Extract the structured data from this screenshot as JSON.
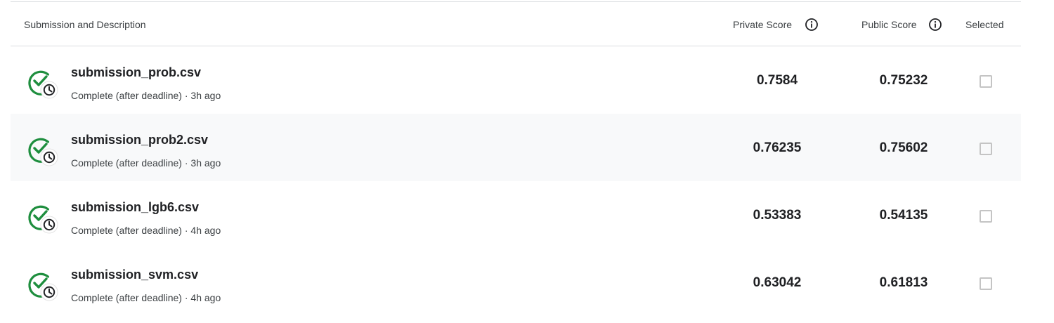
{
  "columns": {
    "description": "Submission and Description",
    "private_score": "Private Score",
    "public_score": "Public Score",
    "selected": "Selected"
  },
  "icons": {
    "info": "info-icon",
    "status": "check-clock-icon"
  },
  "colors": {
    "success_green": "#1e8e3e",
    "row_alt_bg": "#f8f9fa",
    "divider": "#dadce0"
  },
  "submissions": [
    {
      "filename": "submission_prob.csv",
      "status": "Complete (after deadline) · 3h ago",
      "private_score": "0.7584",
      "public_score": "0.75232",
      "selected": false
    },
    {
      "filename": "submission_prob2.csv",
      "status": "Complete (after deadline) · 3h ago",
      "private_score": "0.76235",
      "public_score": "0.75602",
      "selected": false
    },
    {
      "filename": "submission_lgb6.csv",
      "status": "Complete (after deadline) · 4h ago",
      "private_score": "0.53383",
      "public_score": "0.54135",
      "selected": false
    },
    {
      "filename": "submission_svm.csv",
      "status": "Complete (after deadline) · 4h ago",
      "private_score": "0.63042",
      "public_score": "0.61813",
      "selected": false
    }
  ]
}
